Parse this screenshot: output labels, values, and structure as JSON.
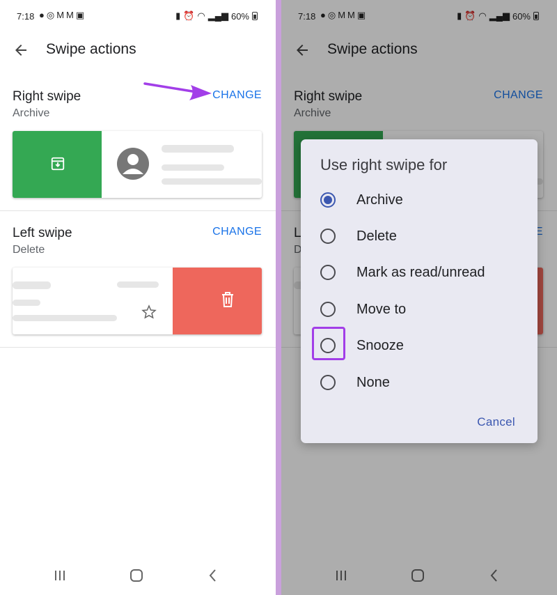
{
  "status": {
    "time": "7:18",
    "battery": "60%"
  },
  "screen": {
    "title": "Swipe actions"
  },
  "right_swipe": {
    "title": "Right swipe",
    "value": "Archive",
    "change_label": "CHANGE"
  },
  "left_swipe": {
    "title": "Left swipe",
    "value": "Delete",
    "change_label": "CHANGE"
  },
  "dialog": {
    "title": "Use right swipe for",
    "options": [
      {
        "label": "Archive",
        "selected": true
      },
      {
        "label": "Delete",
        "selected": false
      },
      {
        "label": "Mark as read/unread",
        "selected": false
      },
      {
        "label": "Move to",
        "selected": false
      },
      {
        "label": "Snooze",
        "selected": false,
        "highlighted": true
      },
      {
        "label": "None",
        "selected": false
      }
    ],
    "cancel_label": "Cancel"
  },
  "colors": {
    "accent": "#1a73e8",
    "archive_green": "#34a853",
    "delete_red": "#ee675c",
    "highlight_purple": "#a23ee8"
  }
}
